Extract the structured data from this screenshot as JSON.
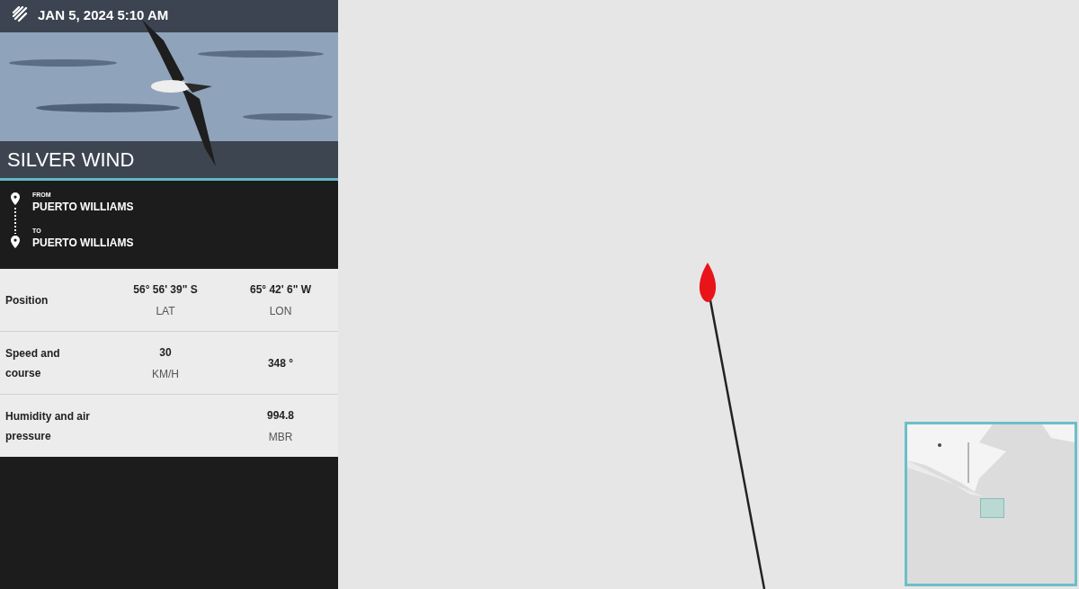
{
  "header": {
    "datetime": "JAN 5, 2024 5:10 AM",
    "ship_name": "SILVER WIND"
  },
  "route": [
    {
      "label": "FROM",
      "port": "PUERTO WILLIAMS"
    },
    {
      "label": "TO",
      "port": "PUERTO WILLIAMS"
    }
  ],
  "stats": [
    {
      "label": "Position",
      "first": {
        "value": "56° 56' 39\" S",
        "unit": "LAT"
      },
      "second": {
        "value": "65° 42' 6\" W",
        "unit": "LON"
      }
    },
    {
      "label": "Speed and course",
      "first": {
        "value": "30",
        "unit": "KM/H"
      },
      "second": {
        "value": "348 °"
      }
    },
    {
      "label": "Humidity and air pressure",
      "second": {
        "value": "994.8",
        "unit": "MBR"
      }
    }
  ]
}
